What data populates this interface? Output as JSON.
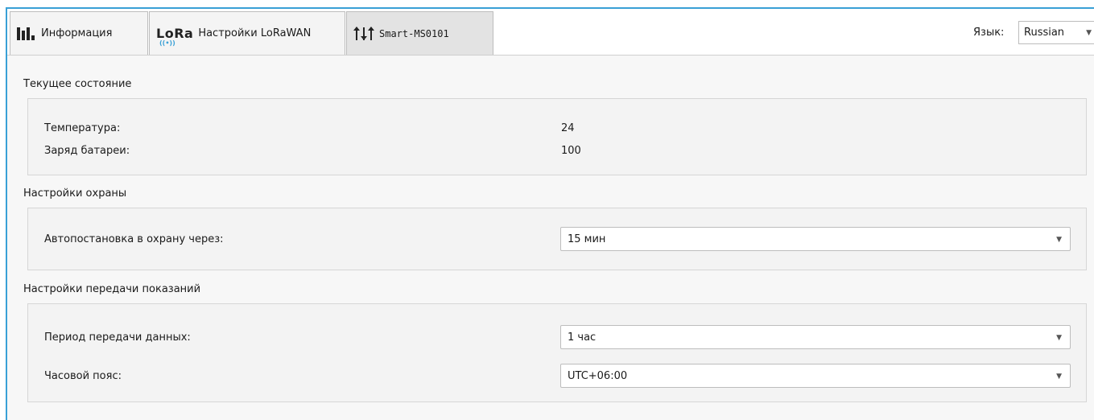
{
  "tabs": [
    {
      "label": "Информация",
      "icon": "bar-chart-icon"
    },
    {
      "label": "Настройки LoRaWAN",
      "icon": "lora-logo-icon",
      "logo_text": "LoRa"
    },
    {
      "label": "Smart-MS0101",
      "icon": "sliders-icon"
    }
  ],
  "language": {
    "label": "Язык:",
    "value": "Russian"
  },
  "current_state": {
    "title": "Текущее состояние",
    "rows": [
      {
        "label": "Температура:",
        "value": "24"
      },
      {
        "label": "Заряд батареи:",
        "value": "100"
      }
    ]
  },
  "security": {
    "title": "Настройки охраны",
    "auto_arm": {
      "label": "Автопостановка в охрану через:",
      "value": "15 мин"
    }
  },
  "transmission": {
    "title": "Настройки передачи показаний",
    "period": {
      "label": "Период передачи данных:",
      "value": "1 час"
    },
    "timezone": {
      "label": "Часовой пояс:",
      "value": "UTC+06:00"
    }
  },
  "colors": {
    "accent": "#39a0d6",
    "active_tab": "#e3e3e3"
  }
}
